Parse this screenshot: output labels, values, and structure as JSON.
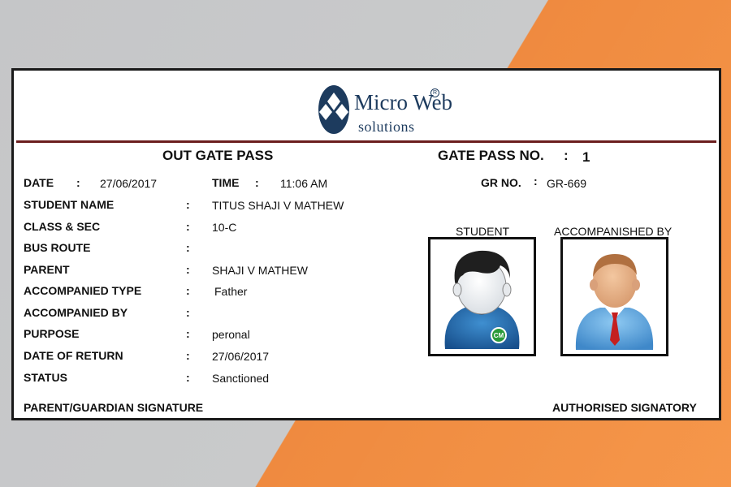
{
  "brand": {
    "name": "Micro Web",
    "sub": "solutions",
    "reg": "R"
  },
  "pass": {
    "title": "OUT GATE PASS",
    "pass_no_label": "GATE PASS NO.",
    "pass_no_colon": ":",
    "pass_no": "1",
    "gr_label": "GR NO.",
    "gr_colon": ":",
    "gr_no": "GR-669",
    "date_label": "DATE",
    "date_colon": ":",
    "date": "27/06/2017",
    "time_label": "TIME",
    "time_colon": ":",
    "time": "11:06 AM"
  },
  "fields": [
    {
      "label": "STUDENT NAME",
      "colon": ":",
      "value": "TITUS SHAJI V MATHEW"
    },
    {
      "label": "CLASS & SEC",
      "colon": ":",
      "value": "10-C"
    },
    {
      "label": "BUS ROUTE",
      "colon": ":",
      "value": ""
    },
    {
      "label": "PARENT",
      "colon": ":",
      "value": "SHAJI V MATHEW"
    },
    {
      "label": "ACCOMPANIED TYPE",
      "colon": ":",
      "value": "Father"
    },
    {
      "label": "ACCOMPANIED BY",
      "colon": ":",
      "value": ""
    },
    {
      "label": "PURPOSE",
      "colon": ":",
      "value": "peronal"
    },
    {
      "label": "DATE OF RETURN",
      "colon": ":",
      "value": "27/06/2017"
    },
    {
      "label": "STATUS",
      "colon": ":",
      "value": "Sanctioned"
    }
  ],
  "photos": {
    "student_label": "STUDENT",
    "accompanied_label": "ACCOMPANISHED BY",
    "student_icon": "student-avatar-icon",
    "accompanied_icon": "man-avatar-icon",
    "badge_text": "CM"
  },
  "footer": {
    "left": "PARENT/GUARDIAN SIGNATURE",
    "right": "AUTHORISED SIGNATORY"
  },
  "colors": {
    "brand": "#1d3b5e",
    "header_rule": "#6b1e1e",
    "background_left": "#c5c6c8",
    "background_right": "#f5903f"
  }
}
